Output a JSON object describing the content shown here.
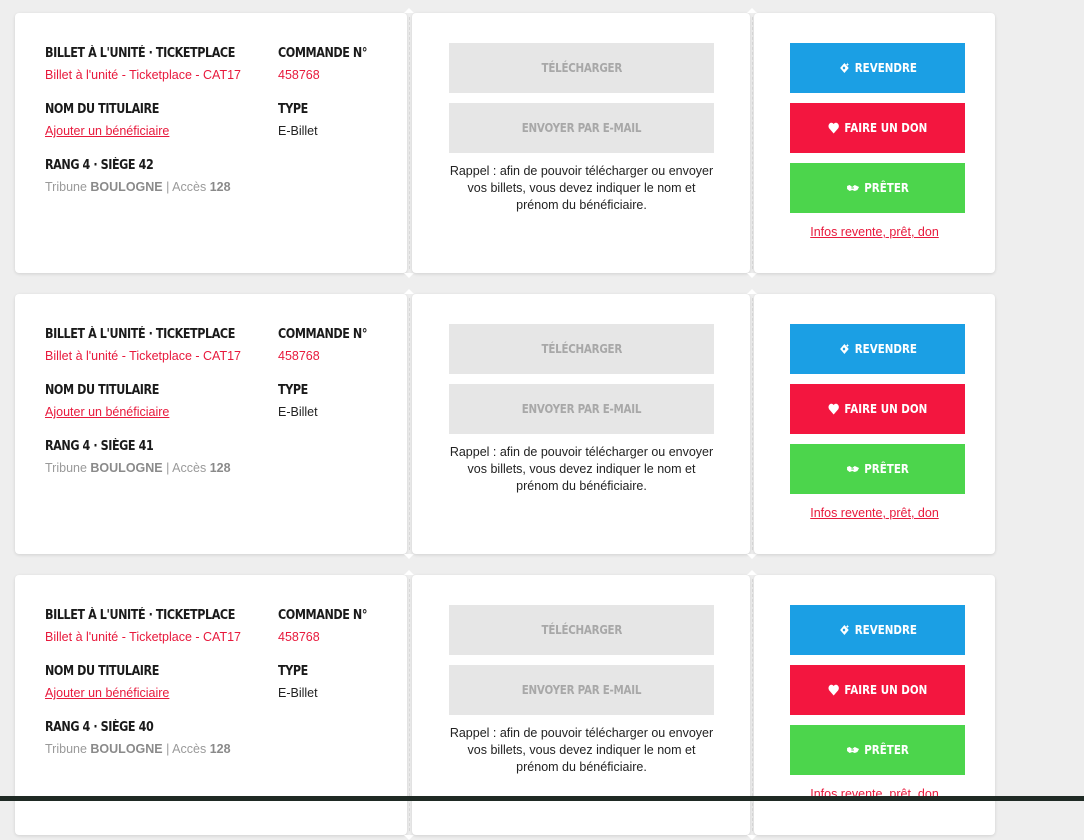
{
  "tickets": [
    {
      "product_heading": "BILLET À L'UNITÉ · TICKETPLACE",
      "product_detail": "Billet à l'unité - Ticketplace - CAT17",
      "order_heading": "COMMANDE N°",
      "order_number": "458768",
      "holder_heading": "NOM DU TITULAIRE",
      "holder_link": "Ajouter un bénéficiaire",
      "type_heading": "TYPE",
      "type_value": "E-Billet",
      "seat": "RANG 4 · SIÈGE 42",
      "stand_prefix": "Tribune",
      "stand_name": "BOULOGNE",
      "access_prefix": "| Accès",
      "access_number": "128",
      "download_label": "TÉLÉCHARGER",
      "email_label": "ENVOYER PAR E-MAIL",
      "reminder": "Rappel : afin de pouvoir télécharger ou envoyer vos billets, vous devez indiquer le nom et prénom du bénéficiaire.",
      "resell_label": "REVENDRE",
      "donate_label": "FAIRE UN DON",
      "lend_label": "PRÊTER",
      "info_link": "Infos revente, prêt, don"
    },
    {
      "product_heading": "BILLET À L'UNITÉ · TICKETPLACE",
      "product_detail": "Billet à l'unité - Ticketplace - CAT17",
      "order_heading": "COMMANDE N°",
      "order_number": "458768",
      "holder_heading": "NOM DU TITULAIRE",
      "holder_link": "Ajouter un bénéficiaire",
      "type_heading": "TYPE",
      "type_value": "E-Billet",
      "seat": "RANG 4 · SIÈGE 41",
      "stand_prefix": "Tribune",
      "stand_name": "BOULOGNE",
      "access_prefix": "| Accès",
      "access_number": "128",
      "download_label": "TÉLÉCHARGER",
      "email_label": "ENVOYER PAR E-MAIL",
      "reminder": "Rappel : afin de pouvoir télécharger ou envoyer vos billets, vous devez indiquer le nom et prénom du bénéficiaire.",
      "resell_label": "REVENDRE",
      "donate_label": "FAIRE UN DON",
      "lend_label": "PRÊTER",
      "info_link": "Infos revente, prêt, don"
    },
    {
      "product_heading": "BILLET À L'UNITÉ · TICKETPLACE",
      "product_detail": "Billet à l'unité - Ticketplace - CAT17",
      "order_heading": "COMMANDE N°",
      "order_number": "458768",
      "holder_heading": "NOM DU TITULAIRE",
      "holder_link": "Ajouter un bénéficiaire",
      "type_heading": "TYPE",
      "type_value": "E-Billet",
      "seat": "RANG 4 · SIÈGE 40",
      "stand_prefix": "Tribune",
      "stand_name": "BOULOGNE",
      "access_prefix": "| Accès",
      "access_number": "128",
      "download_label": "TÉLÉCHARGER",
      "email_label": "ENVOYER PAR E-MAIL",
      "reminder": "Rappel : afin de pouvoir télécharger ou envoyer vos billets, vous devez indiquer le nom et prénom du bénéficiaire.",
      "resell_label": "REVENDRE",
      "donate_label": "FAIRE UN DON",
      "lend_label": "PRÊTER",
      "info_link": "Infos revente, prêt, don"
    }
  ],
  "icons": {
    "resell": "ticket-sparkle-icon",
    "donate": "heart-icon",
    "lend": "handshake-icon"
  },
  "colors": {
    "accent_red": "#e8193c",
    "resell_blue": "#1b9fe4",
    "donate_red": "#f3163f",
    "lend_green": "#4cd54c",
    "disabled_gray": "#e6e6e6"
  }
}
